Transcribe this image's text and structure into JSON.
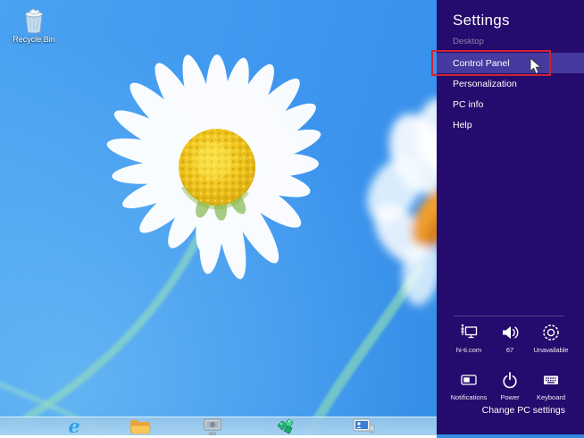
{
  "desktop": {
    "recycle_bin_label": "Recycle Bin"
  },
  "taskbar": {
    "icons": [
      {
        "name": "internet-explorer-icon",
        "glyph": "e"
      },
      {
        "name": "file-explorer-icon"
      },
      {
        "name": "media-app-icon"
      },
      {
        "name": "gems-app-icon"
      },
      {
        "name": "pc-app-icon"
      }
    ]
  },
  "settings_panel": {
    "title": "Settings",
    "context": "Desktop",
    "items": [
      {
        "label": "Control Panel",
        "highlighted": true
      },
      {
        "label": "Personalization",
        "highlighted": false
      },
      {
        "label": "PC info",
        "highlighted": false
      },
      {
        "label": "Help",
        "highlighted": false
      }
    ],
    "tiles": [
      {
        "icon": "network-icon",
        "label": "hi-ti.com"
      },
      {
        "icon": "volume-icon",
        "label": "67"
      },
      {
        "icon": "brightness-icon",
        "label": "Unavailable"
      },
      {
        "icon": "notifications-icon",
        "label": "Notifications"
      },
      {
        "icon": "power-icon",
        "label": "Power"
      },
      {
        "icon": "keyboard-icon",
        "label": "Keyboard"
      }
    ],
    "footer_link": "Change PC settings"
  },
  "annotation": {
    "color": "#cf2233"
  },
  "colors": {
    "panel_bg": "#250b6d",
    "highlight_bg": "#46399f",
    "sky_main": "#3f96f5",
    "sky_light": "#4fa8e8",
    "taskbar": "#9fcbe9"
  }
}
